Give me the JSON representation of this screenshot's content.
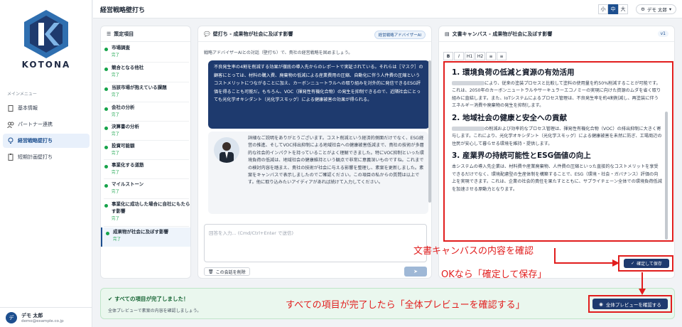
{
  "app": {
    "name": "KOTONA",
    "page_title": "経営戦略壁打ち"
  },
  "sidebar": {
    "heading": "メインメニュー",
    "items": [
      {
        "label": "基本情報"
      },
      {
        "label": "パートナー連携"
      },
      {
        "label": "経営戦略壁打ち"
      },
      {
        "label": "短期計画壁打ち"
      }
    ]
  },
  "user": {
    "initial": "デ",
    "name": "デモ 太郎",
    "email": "demo@example.co.jp",
    "menu_label": "デモ 太郎"
  },
  "font_size": {
    "options": [
      "小",
      "中",
      "大"
    ],
    "selected": "中"
  },
  "steps": {
    "title": "策定項目",
    "items": [
      {
        "label": "市場調査",
        "status": "完了"
      },
      {
        "label": "競合となる他社",
        "status": "完了"
      },
      {
        "label": "当該市場が抱えている課題",
        "status": "完了"
      },
      {
        "label": "会社の分析",
        "status": "完了"
      },
      {
        "label": "決算書の分析",
        "status": "完了"
      },
      {
        "label": "投資可能額",
        "status": "完了"
      },
      {
        "label": "事業化する道筋",
        "status": "完了"
      },
      {
        "label": "マイルストーン",
        "status": "完了"
      },
      {
        "label": "事業化に成功した場合に自社にもたらす影響",
        "status": "完了"
      },
      {
        "label": "成果物が社会に及ぼす影響",
        "status": "完了"
      }
    ]
  },
  "chat": {
    "title": "壁打ち - 成果物が社会に及ぼす影響",
    "badge": "経営戦略アドバイザーAI",
    "subtitle": "戦略アドバイザーAIとの対話（壁打ち）で、貴社の経営戦略を固めましょう。",
    "user_message": "不良発生率の4割を削減する効果が徹底の導入先からのレポートで実証されている。それらは［マスク］の顧客にとっては、材料の購入費、廃棄物の低減による産業費用の圧縮、自動化に伴う人件費の圧縮というコストメリットにつながることに加え、カーボンニュートラルへの取り組みを対外的に発信できるESG評価を得ることも可能だ。もちろん、VOC（揮発性有機化合物）の発生を抑制できるので、近隣社会にとっても光化学オキシダント（光化学スモッグ）による健康被害の効果が得られる。",
    "ai_message": "詳細なご説明をありがとうございます。コスト削減という経済的側面だけでなく、ESG経営の推進、そしてVOC排出抑制による地域社会への健康被害低減まで、貴社の技術が多層的な社会的インパクトを持っていることがよく理解できました。特にVOC抑制といった環境負荷の低減は、地域社会の健康維持という観点で非常に意義深いものですね。これまでの検討内容を踏まえ、貴社の技術が社会に与える影響を整理し、素案を更新しました。素案をキャンバスで表示しましたのでご確認ください。この項目の私からの質問は以上です。他に取り込みたいアイディアがあれば続けて入力してください。",
    "input_placeholder": "回答を入力... (Cmd/Ctrl+Enter で送信)",
    "clear_label": "この会話を削除"
  },
  "canvas": {
    "title": "文書キャンバス - 成果物が社会に及ぼす影響",
    "version": "v1",
    "toolbar": [
      "B",
      "I",
      "H1",
      "H2",
      "≡",
      "≡"
    ],
    "sections": [
      {
        "heading": "1. 環境負荷の低減と資源の有効活用",
        "body": "により、従来の塗装プロセスと比較して塗料の使用量を約50%削減することが可能です。これは、2050年のカーボンニュートラルやサーキュラーエコノミーの実現に向けた資源のムダを省く取り組みに直結します。また、IoTシステムによるプロセス管理は、不良発生率を約4割削減し、再塗装に伴うエネルギー消費や廃棄物の発生を抑制します。"
      },
      {
        "heading": "2. 地域社会の健康と安全への貢献",
        "body": "の削減および効率的なプロセス管理は、揮発性有機化合物（VOC）の排出抑制に大きく寄与します。これにより、光化学オキシダント（光化学スモッグ）による健康被害を未然に防ぎ、工場周辺の住民が安心して暮らせる環境を維持・提供します。"
      },
      {
        "heading": "3. 産業界の持続可能性とESG価値の向上",
        "body": "本システムの導入先企業は、材料費や産業廃棄物、人件費の圧縮といった直接的なコストメリットを享受できるだけでなく、環境配慮型の生産体制を構築することで、ESG（環境・社会・ガバナンス）評価の向上を実現できます。これは、企業の社会的責任を果たすとともに、サプライチェーン全体での環境負荷低減を加速させる原動力となります。"
      }
    ],
    "save_label": "確定して保存"
  },
  "completion": {
    "title": "すべての項目が完了しました！",
    "subtitle": "全体プレビューで素案の内容を確認しましょう。",
    "preview_label": "全体プレビューを確認する"
  },
  "annotations": {
    "check_canvas": "文書キャンバスの内容を確認",
    "ok_save": "OKなら「確定して保存」",
    "all_done": "すべての項目が完了したら「全体プレビューを確認する」"
  },
  "colors": {
    "brand": "#1e3a6e",
    "accent": "#e11d1d",
    "done": "#16a34a"
  }
}
